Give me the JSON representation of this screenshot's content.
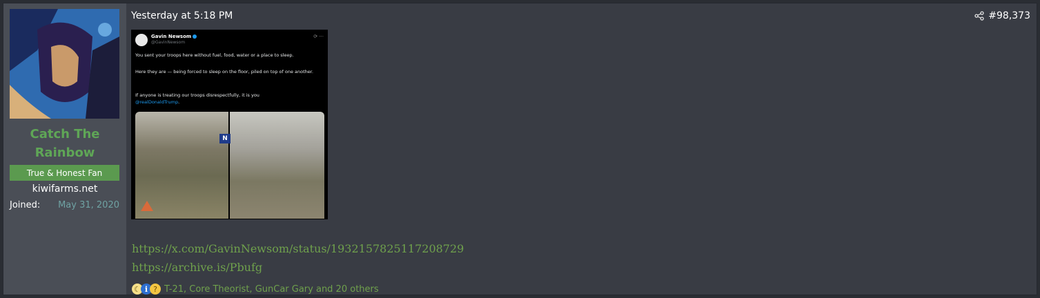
{
  "user": {
    "name": "Catch The Rainbow",
    "title": "True & Honest Fan",
    "site": "kiwifarms.net",
    "joined_label": "Joined:",
    "joined_value": "May 31, 2020"
  },
  "post": {
    "timestamp": "Yesterday at 5:18 PM",
    "number": "#98,373"
  },
  "tweet": {
    "author": "Gavin Newsom",
    "handle": "@GavinNewsom",
    "line1": "You sent your troops here without fuel, food, water or a place to sleep.",
    "line2": "Here they are — being forced to sleep on the floor, piled on top of one another.",
    "line3": "If anyone is treating our troops disrespectfully, it is you",
    "mention": "@realDonaldTrump",
    "mention_suffix": ".",
    "badge": "N"
  },
  "links": [
    "https://x.com/GavinNewsom/status/1932157825117208729",
    "https://archive.is/Pbufg"
  ],
  "reactions": {
    "icons": [
      "moon-icon",
      "info-icon",
      "thinking-icon"
    ],
    "text": "T-21, Core Theorist, GunCar Gary and 20 others"
  },
  "colors": {
    "accent_green": "#6fa14c",
    "username_green": "#5fa656",
    "title_bg": "#5b9a4f",
    "post_bg": "#393c44",
    "sidebar_bg": "#4a4e56"
  }
}
